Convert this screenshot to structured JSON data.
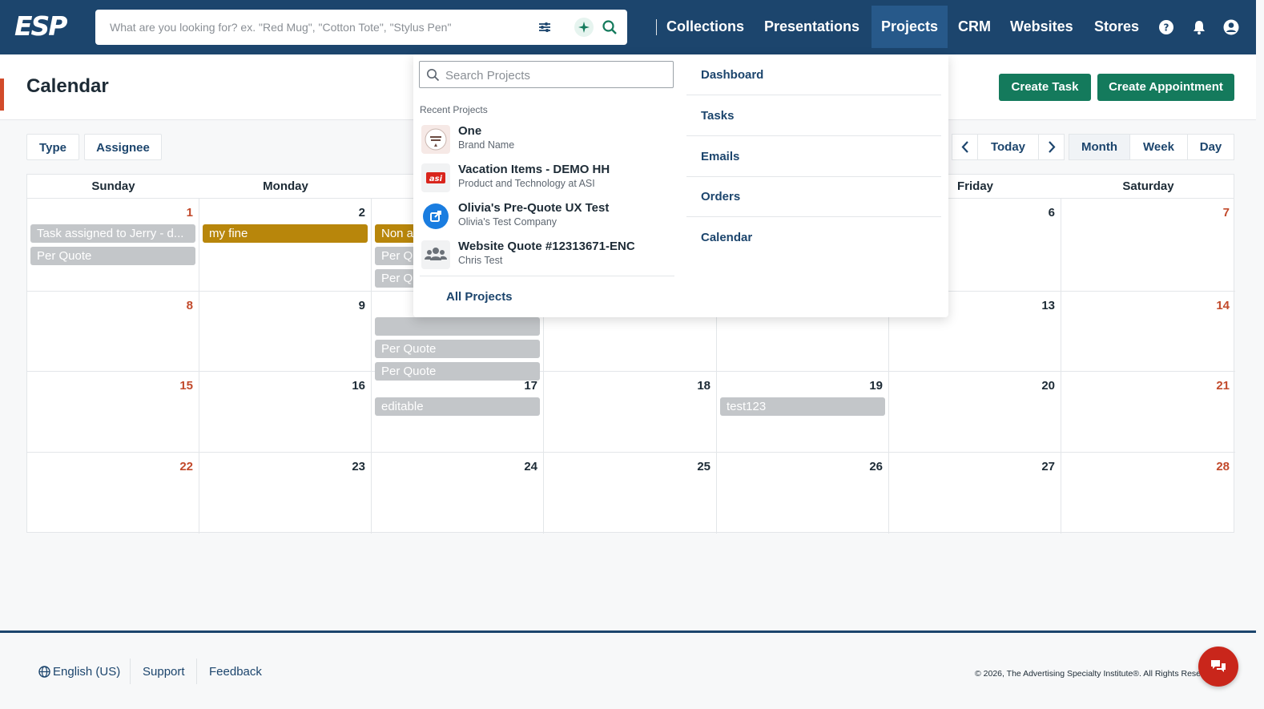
{
  "nav": {
    "logo_text": "ESP",
    "search_placeholder": "What are you looking for? ex. \"Red Mug\", \"Cotton Tote\", \"Stylus Pen\"",
    "links": [
      "Collections",
      "Presentations",
      "Projects",
      "CRM",
      "Websites",
      "Stores"
    ],
    "active_link": "Projects",
    "icons": [
      "filter-icon",
      "ai-sparkle-icon",
      "search-icon",
      "help-icon",
      "bell-icon",
      "user-account-icon"
    ]
  },
  "header": {
    "title": "Calendar",
    "create_task_label": "Create Task",
    "create_appointment_label": "Create Appointment"
  },
  "filters": {
    "type_label": "Type",
    "assignee_label": "Assignee"
  },
  "view_controls": {
    "today_label": "Today",
    "views": [
      "Month",
      "Week",
      "Day"
    ],
    "active_view": "Month"
  },
  "calendar": {
    "days_of_week": [
      "Sunday",
      "Monday",
      "",
      "",
      "",
      "Friday",
      "Saturday"
    ],
    "weeks": [
      {
        "days": [
          {
            "num": "1",
            "events": [
              {
                "text": "Task assigned to Jerry - d...",
                "style": "gray"
              },
              {
                "text": "Per Quote",
                "style": "gray"
              }
            ]
          },
          {
            "num": "2",
            "events": [
              {
                "text": "my fine",
                "style": "gold"
              }
            ]
          },
          {
            "num": "",
            "events": [
              {
                "text": "Non a",
                "style": "gold"
              },
              {
                "text": "Per Qu",
                "style": "gray"
              },
              {
                "text": "Per Qu",
                "style": "gray"
              }
            ]
          },
          {
            "num": "",
            "events": []
          },
          {
            "num": "",
            "events": []
          },
          {
            "num": "6",
            "events": []
          },
          {
            "num": "7",
            "events": []
          }
        ]
      },
      {
        "days": [
          {
            "num": "8",
            "events": []
          },
          {
            "num": "9",
            "events": []
          },
          {
            "num": "",
            "events": [
              {
                "text": "",
                "style": "gray",
                "hidden_top": true
              },
              {
                "text": "Per Quote",
                "style": "gray"
              },
              {
                "text": "Per Quote",
                "style": "gray"
              }
            ]
          },
          {
            "num": "",
            "events": []
          },
          {
            "num": "",
            "events": []
          },
          {
            "num": "13",
            "events": []
          },
          {
            "num": "14",
            "events": []
          }
        ]
      },
      {
        "days": [
          {
            "num": "15",
            "events": []
          },
          {
            "num": "16",
            "events": []
          },
          {
            "num": "17",
            "events": [
              {
                "text": "editable",
                "style": "gray"
              }
            ]
          },
          {
            "num": "18",
            "events": []
          },
          {
            "num": "19",
            "events": [
              {
                "text": "test123",
                "style": "gray"
              }
            ]
          },
          {
            "num": "20",
            "events": []
          },
          {
            "num": "21",
            "events": []
          }
        ]
      },
      {
        "days": [
          {
            "num": "22",
            "events": []
          },
          {
            "num": "23",
            "events": []
          },
          {
            "num": "24",
            "events": []
          },
          {
            "num": "25",
            "events": []
          },
          {
            "num": "26",
            "events": []
          },
          {
            "num": "27",
            "events": []
          },
          {
            "num": "28",
            "events": []
          }
        ]
      }
    ]
  },
  "projects_dropdown": {
    "search_placeholder": "Search Projects",
    "recent_label": "Recent Projects",
    "recent": [
      {
        "name": "One",
        "subtitle": "Brand Name",
        "thumb": "brand-name-logo"
      },
      {
        "name": "Vacation Items - DEMO HH",
        "subtitle": "Product and Technology at ASI",
        "thumb": "asi-logo",
        "thumb_text": "asi"
      },
      {
        "name": "Olivia's Pre-Quote UX Test",
        "subtitle": "Olivia's Test Company",
        "thumb": "company-icon"
      },
      {
        "name": "Website Quote #12313671-ENC",
        "subtitle": "Chris Test",
        "thumb": "group-icon"
      }
    ],
    "all_projects_label": "All Projects",
    "menu": [
      "Dashboard",
      "Tasks",
      "Emails",
      "Orders",
      "Calendar"
    ]
  },
  "footer": {
    "language": "English (US)",
    "support": "Support",
    "feedback": "Feedback",
    "copyright": "© 2026, The Advertising Specialty Institute®. All Rights Reserved."
  },
  "colors": {
    "nav_bg": "#1c456d",
    "nav_active": "#27598a",
    "primary_green": "#147a5c",
    "weekend_red": "#c24a2c",
    "event_gray": "#c3c6c9",
    "event_gold": "#b8860b",
    "chat_red": "#c9261b"
  }
}
